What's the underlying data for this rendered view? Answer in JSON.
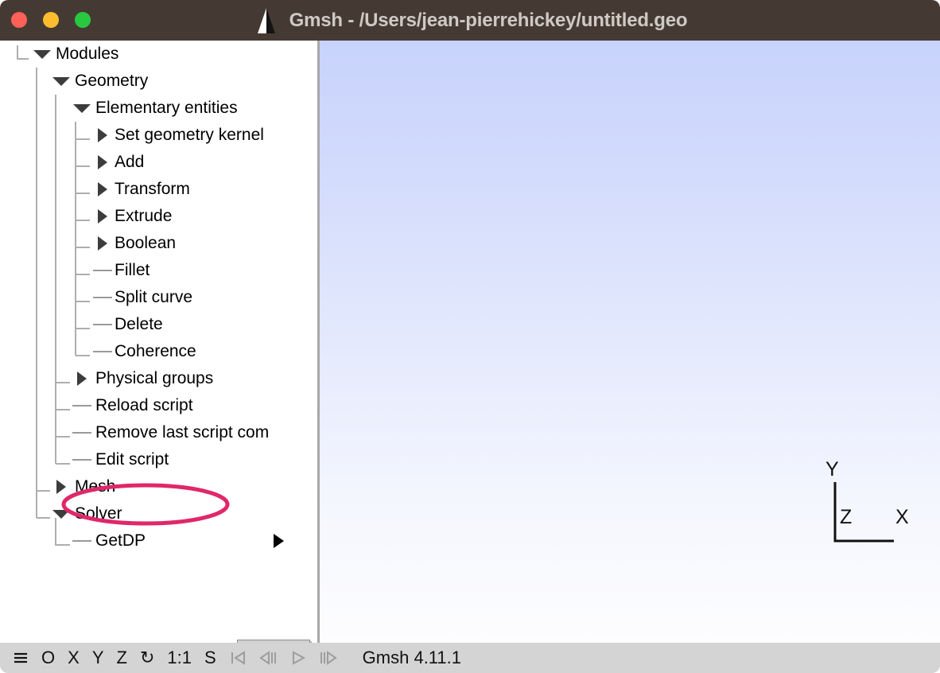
{
  "window": {
    "title": "Gmsh - /Users/jean-pierrehickey/untitled.geo",
    "titlebar_bg": "#453A33",
    "title_color": "#CFC9C4",
    "traffic_lights": [
      {
        "name": "close",
        "color": "#FF6057"
      },
      {
        "name": "minimize",
        "color": "#FFBD2E"
      },
      {
        "name": "maximize",
        "color": "#28C840"
      }
    ],
    "logo_icon": "gmsh-pyramid-logo"
  },
  "sidebar": {
    "tree": [
      {
        "label": "Modules",
        "depth": 0,
        "marker": "expanded"
      },
      {
        "label": "Geometry",
        "depth": 1,
        "marker": "expanded"
      },
      {
        "label": "Elementary entities",
        "depth": 2,
        "marker": "expanded"
      },
      {
        "label": "Set geometry kernel",
        "depth": 3,
        "marker": "collapsed"
      },
      {
        "label": "Add",
        "depth": 3,
        "marker": "collapsed"
      },
      {
        "label": "Transform",
        "depth": 3,
        "marker": "collapsed"
      },
      {
        "label": "Extrude",
        "depth": 3,
        "marker": "collapsed"
      },
      {
        "label": "Boolean",
        "depth": 3,
        "marker": "collapsed"
      },
      {
        "label": "Fillet",
        "depth": 3,
        "marker": "leaf"
      },
      {
        "label": "Split curve",
        "depth": 3,
        "marker": "leaf"
      },
      {
        "label": "Delete",
        "depth": 3,
        "marker": "leaf"
      },
      {
        "label": "Coherence",
        "depth": 3,
        "marker": "leaf"
      },
      {
        "label": "Physical groups",
        "depth": 2,
        "marker": "collapsed"
      },
      {
        "label": "Reload script",
        "depth": 2,
        "marker": "leaf"
      },
      {
        "label": "Remove last script com",
        "depth": 2,
        "marker": "leaf"
      },
      {
        "label": "Edit script",
        "depth": 2,
        "marker": "leaf",
        "annotated": true
      },
      {
        "label": "Mesh",
        "depth": 1,
        "marker": "collapsed"
      },
      {
        "label": "Solver",
        "depth": 1,
        "marker": "expanded"
      },
      {
        "label": "GetDP",
        "depth": 2,
        "marker": "leaf",
        "submenu_arrow": true
      }
    ],
    "options_button": {
      "gear_icon": "gear-icon",
      "caret_icon": "triangle-down-icon"
    }
  },
  "annotation": {
    "shape": "ellipse",
    "target": "Edit script",
    "color": "#E0276A",
    "stroke_width": 5
  },
  "viewport": {
    "gradient_top": "#C8D3FC",
    "gradient_bottom": "#FDFDFF",
    "axes": {
      "x_label": "X",
      "y_label": "Y",
      "z_label": "Z"
    }
  },
  "statusbar": {
    "icons": [
      {
        "name": "menu-icon",
        "glyph": "≡"
      },
      {
        "name": "origin-icon",
        "glyph": "O"
      },
      {
        "name": "x-axis-icon",
        "glyph": "X"
      },
      {
        "name": "y-axis-icon",
        "glyph": "Y"
      },
      {
        "name": "z-axis-icon",
        "glyph": "Z"
      },
      {
        "name": "rotate-icon",
        "glyph": "↻"
      }
    ],
    "scale_label": "1:1",
    "select_label": "S",
    "playback": [
      {
        "name": "skip-to-start-icon"
      },
      {
        "name": "step-backward-icon"
      },
      {
        "name": "play-icon"
      },
      {
        "name": "step-forward-icon"
      }
    ],
    "version": "Gmsh 4.11.1"
  }
}
